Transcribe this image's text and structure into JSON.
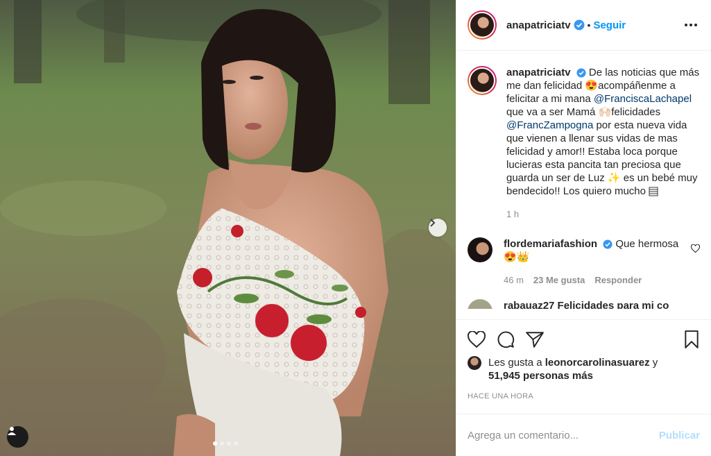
{
  "post": {
    "author": "anapatriciatv",
    "follow_label": "Seguir",
    "separator": "•"
  },
  "caption": {
    "username": "anapatriciatv",
    "text_1": "De las noticias que más me dan felicidad 😍acompáñenme a felicitar a mi mana",
    "mention_1": "@FranciscaLachapel",
    "text_2": "que va a ser Mamá 🙌🏻felicidades",
    "mention_2": "@FrancZampogna",
    "text_3": "por esta nueva vida que vienen a llenar sus vidas de mas felicidad y amor!! Estaba loca porque lucieras esta pancita tan preciosa que guarda un ser de Luz ✨ es un bebé muy bendecido!! Los quiero mucho",
    "time": "1 h"
  },
  "comments": [
    {
      "username": "flordemariafashion",
      "text": "Que hermosa 😍👑",
      "time": "46 m",
      "likes": "23 Me gusta",
      "reply_label": "Responder"
    }
  ],
  "cut_comment": {
    "text": "rabauaz27 Felicidades para mi co"
  },
  "likes": {
    "prefix": "Les gusta a",
    "user": "leonorcarolinasuarez",
    "conj": "y",
    "others": "51,945 personas más"
  },
  "timestamp": "HACE UNA HORA",
  "add_comment": {
    "placeholder": "Agrega un comentario...",
    "publish_label": "Publicar"
  },
  "carousel": {
    "count": 4,
    "active_index": 0
  },
  "colors": {
    "accent": "#0095f6",
    "publish_disabled": "#b2dffc",
    "muted": "#8e8e8e",
    "mention": "#00376b"
  },
  "icons": [
    "verified-icon",
    "more-options-icon",
    "heart-icon",
    "comment-icon",
    "share-icon",
    "save-icon",
    "chevron-right-icon",
    "user-tag-icon"
  ]
}
